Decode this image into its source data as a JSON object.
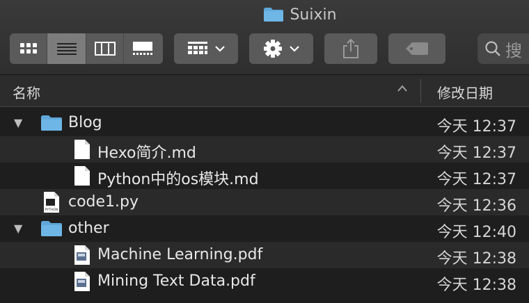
{
  "window": {
    "title": "Suixin"
  },
  "toolbar": {
    "view_modes": [
      "icon-view",
      "list-view",
      "column-view",
      "gallery-view"
    ],
    "active_view": "list-view",
    "search_text": "搜"
  },
  "columns": {
    "name": "名称",
    "date_modified": "修改日期",
    "sort_indicator": "^"
  },
  "files": [
    {
      "name": "Blog",
      "type": "folder",
      "date": "今天 12:37",
      "expanded": true,
      "disclosure": "▼"
    },
    {
      "name": "Hexo简介.md",
      "type": "md",
      "date": "今天 12:37"
    },
    {
      "name": "Python中的os模块.md",
      "type": "md",
      "date": "今天 12:37"
    },
    {
      "name": "code1.py",
      "type": "python",
      "date": "今天 12:36",
      "icon_text": "PYTHON"
    },
    {
      "name": "other",
      "type": "folder",
      "date": "今天 12:40",
      "expanded": true,
      "disclosure": "▼"
    },
    {
      "name": "Machine Learning.pdf",
      "type": "pdf",
      "date": "今天 12:38"
    },
    {
      "name": "Mining Text Data.pdf",
      "type": "pdf",
      "date": "今天 12:38"
    }
  ],
  "colors": {
    "folder": "#5fa8d9",
    "selected_segment": "#7c7c7c",
    "toolbar_button": "#5a5a5a"
  }
}
